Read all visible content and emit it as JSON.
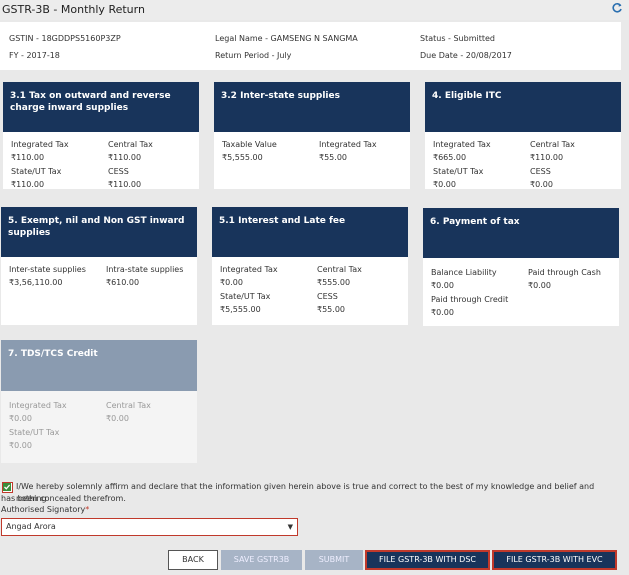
{
  "header": {
    "title": "GSTR-3B - Monthly Return",
    "refresh_icon": "refresh-icon"
  },
  "info": {
    "gstin": "GSTIN - 18GDDPS5160P3ZP",
    "legal_name": "Legal Name - GAMSENG N SANGMA",
    "status": "Status - Submitted",
    "fy": "FY - 2017-18",
    "return_period": "Return Period - July",
    "due_date": "Due Date - 20/08/2017"
  },
  "tiles": {
    "t31": {
      "title_line1": "3.1 Tax on outward and reverse",
      "title_line2": "charge inward supplies",
      "l1": "Integrated Tax",
      "v1": "₹110.00",
      "l2": "Central Tax",
      "v2": "₹110.00",
      "l3": "State/UT Tax",
      "v3": "₹110.00",
      "l4": "CESS",
      "v4": "₹110.00"
    },
    "t32": {
      "title_line1": "3.2 Inter-state supplies",
      "l1": "Taxable Value",
      "v1": "₹5,555.00",
      "l2": "Integrated Tax",
      "v2": "₹55.00"
    },
    "t4": {
      "title_line1": "4. Eligible ITC",
      "l1": "Integrated Tax",
      "v1": "₹665.00",
      "l2": "Central Tax",
      "v2": "₹110.00",
      "l3": "State/UT Tax",
      "v3": "₹0.00",
      "l4": "CESS",
      "v4": "₹0.00"
    },
    "t5": {
      "title_line1": "5. Exempt, nil and Non GST inward",
      "title_line2": "supplies",
      "l1": "Inter-state supplies",
      "v1": "₹3,56,110.00",
      "l2": "Intra-state supplies",
      "v2": "₹610.00"
    },
    "t51": {
      "title_line1": "5.1 Interest and Late fee",
      "l1": "Integrated Tax",
      "v1": "₹0.00",
      "l2": "Central Tax",
      "v2": "₹555.00",
      "l3": "State/UT Tax",
      "v3": "₹5,555.00",
      "l4": "CESS",
      "v4": "₹55.00"
    },
    "t6": {
      "title_line1": "6. Payment of tax",
      "l1": "Balance Liability",
      "v1": "₹0.00",
      "l2": "Paid through Cash",
      "v2": "₹0.00",
      "l3": "Paid through Credit",
      "v3": "₹0.00"
    },
    "t7": {
      "title_line1": "7. TDS/TCS Credit",
      "l1": "Integrated Tax",
      "v1": "₹0.00",
      "l2": "Central Tax",
      "v2": "₹0.00",
      "l3": "State/UT Tax",
      "v3": "₹0.00"
    }
  },
  "declaration": {
    "line1": "I/We hereby solemnly affirm and declare that the information given herein above is true and correct to the best of my knowledge and belief and nothing",
    "line2": "has been concealed therefrom.",
    "checked": true
  },
  "signatory": {
    "label": "Authorised Signatory",
    "required_mark": "*",
    "selected": "Angad Arora"
  },
  "buttons": {
    "back": "BACK",
    "save": "SAVE GSTR3B",
    "submit": "SUBMIT",
    "file_dsc": "FILE GSTR-3B WITH DSC",
    "file_evc": "FILE GSTR-3B WITH EVC"
  },
  "colors": {
    "tile_header": "#18345b",
    "tile_header_muted": "#8a9bb0",
    "highlight": "#c0392b"
  }
}
